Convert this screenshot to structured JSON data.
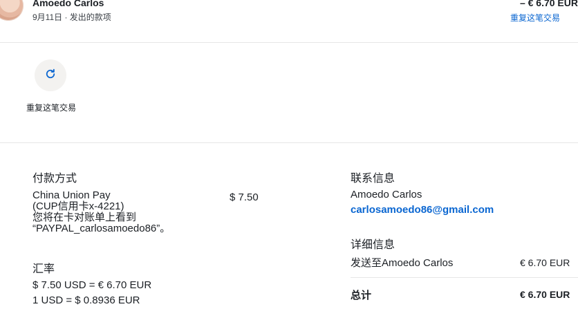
{
  "header": {
    "name": "Amoedo Carlos",
    "subtitle": "9月11日 · 发出的款项",
    "amount": "– € 6.70 EUR",
    "repeat_link": "重复这笔交易"
  },
  "actions": {
    "repeat_label": "重复这笔交易"
  },
  "payment": {
    "heading": "付款方式",
    "method_line1": "China Union Pay",
    "method_line2": "(CUP信用卡x-4221)",
    "method_line3": "您将在卡对账单上看到",
    "method_line4": "“PAYPAL_carlosamoedo86”。",
    "amount": "$ 7.50"
  },
  "exchange": {
    "heading": "汇率",
    "line1": "$ 7.50 USD = € 6.70 EUR",
    "line2": "1 USD = $ 0.8936 EUR"
  },
  "contact": {
    "heading": "联系信息",
    "name": "Amoedo Carlos",
    "email": "carlosamoedo86@gmail.com"
  },
  "details": {
    "heading": "详细信息",
    "sent_to_label": "发送至Amoedo Carlos",
    "sent_to_amount": "€ 6.70 EUR",
    "total_label": "总计",
    "total_amount": "€ 6.70 EUR"
  },
  "colors": {
    "accent": "#0a66d1",
    "text": "#1b1f24",
    "divider": "#e6e6e6"
  }
}
